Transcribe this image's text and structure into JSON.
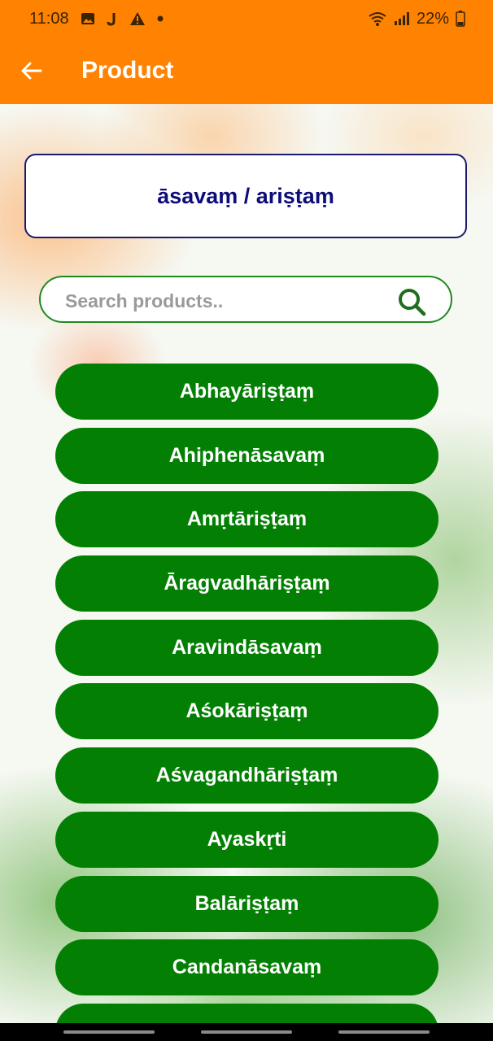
{
  "status_bar": {
    "time": "11:08",
    "left_icons": [
      "gallery-icon",
      "j-notification-icon",
      "warning-icon",
      "dot-icon"
    ],
    "battery": "22%",
    "right_icons": [
      "wifi-icon",
      "signal-icon",
      "battery-icon"
    ]
  },
  "app_bar": {
    "title": "Product",
    "back_icon": "arrow-left-icon"
  },
  "category": {
    "title": "āsavaṃ / ariṣṭaṃ"
  },
  "search": {
    "placeholder": "Search products..",
    "value": "",
    "icon": "search-icon"
  },
  "products": [
    "Abhayāriṣṭaṃ",
    "Ahiphenāsavaṃ",
    "Amṛtāriṣṭaṃ",
    "Āragvadhāriṣṭaṃ",
    "Aravindāsavaṃ",
    "Aśokāriṣṭaṃ",
    "Aśvagandhāriṣṭaṃ",
    "Ayaskṛti",
    "Balāriṣṭaṃ",
    "Candanāsavaṃ",
    ""
  ],
  "colors": {
    "accent": "#ff8200",
    "button_green": "#038003",
    "category_text": "#0d0d7a"
  }
}
